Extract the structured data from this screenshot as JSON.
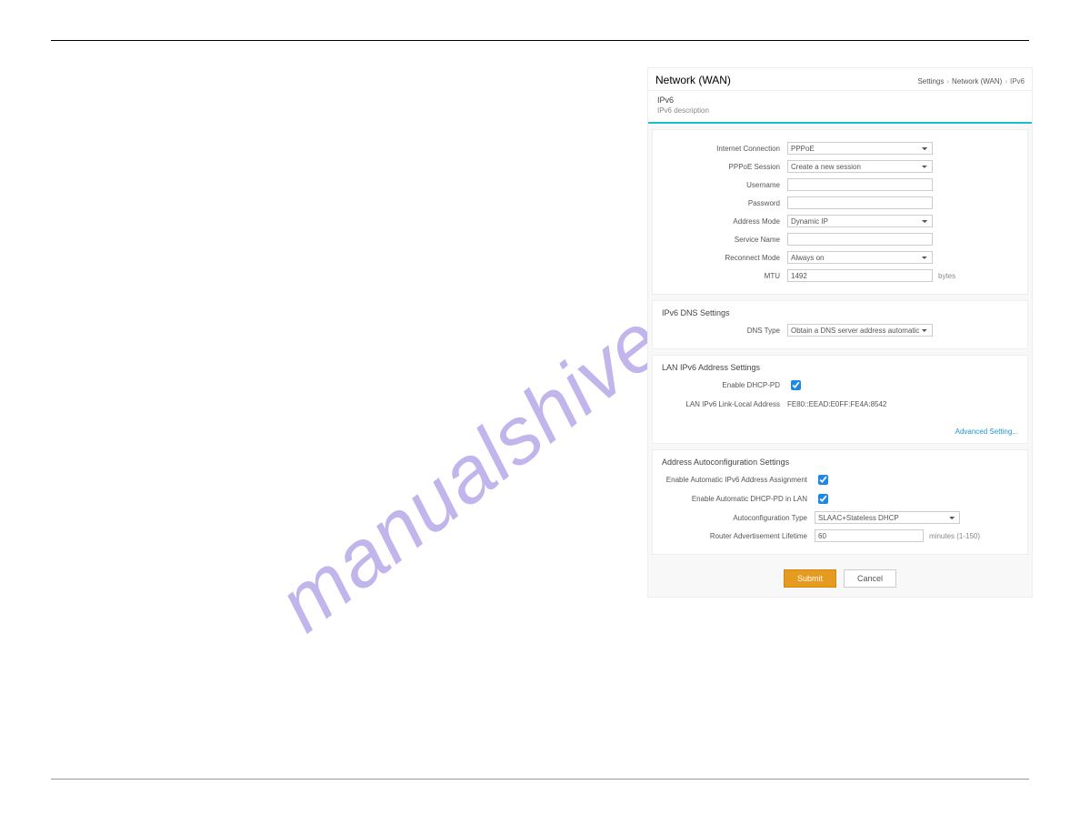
{
  "watermark": "manualshive.com",
  "header": {
    "title": "Network (WAN)",
    "crumbs": [
      "Settings",
      "Network (WAN)",
      "IPv6"
    ]
  },
  "subheader": {
    "title": "IPv6",
    "desc": "IPv6 description"
  },
  "conn": {
    "labels": {
      "internet_connection": "Internet Connection",
      "pppoe_session": "PPPoE Session",
      "username": "Username",
      "password": "Password",
      "address_mode": "Address Mode",
      "service_name": "Service Name",
      "reconnect_mode": "Reconnect Mode",
      "mtu": "MTU"
    },
    "values": {
      "internet_connection": "PPPoE",
      "pppoe_session": "Create a new session",
      "username": "",
      "password": "",
      "address_mode": "Dynamic IP",
      "service_name": "",
      "reconnect_mode": "Always on",
      "mtu": "1492"
    },
    "mtu_suffix": "bytes"
  },
  "dns": {
    "section_title": "IPv6 DNS Settings",
    "labels": {
      "dns_type": "DNS Type"
    },
    "values": {
      "dns_type": "Obtain a DNS server address automatically"
    }
  },
  "lan": {
    "section_title": "LAN IPv6 Address Settings",
    "labels": {
      "enable_dhcp_pd": "Enable DHCP-PD",
      "link_local": "LAN IPv6 Link-Local Address"
    },
    "values": {
      "link_local": "FE80::EEAD:E0FF:FE4A:8542"
    },
    "advanced": "Advanced Setting..."
  },
  "auto": {
    "section_title": "Address Autoconfiguration Settings",
    "labels": {
      "enable_ipv6_assign": "Enable Automatic IPv6 Address Assignment",
      "enable_dhcp_pd_lan": "Enable Automatic DHCP-PD in LAN",
      "auto_type": "Autoconfiguration Type",
      "ra_lifetime": "Router Advertisement Lifetime"
    },
    "values": {
      "auto_type": "SLAAC+Stateless DHCP",
      "ra_lifetime": "60"
    },
    "ra_suffix": "minutes (1-150)"
  },
  "buttons": {
    "submit": "Submit",
    "cancel": "Cancel"
  }
}
